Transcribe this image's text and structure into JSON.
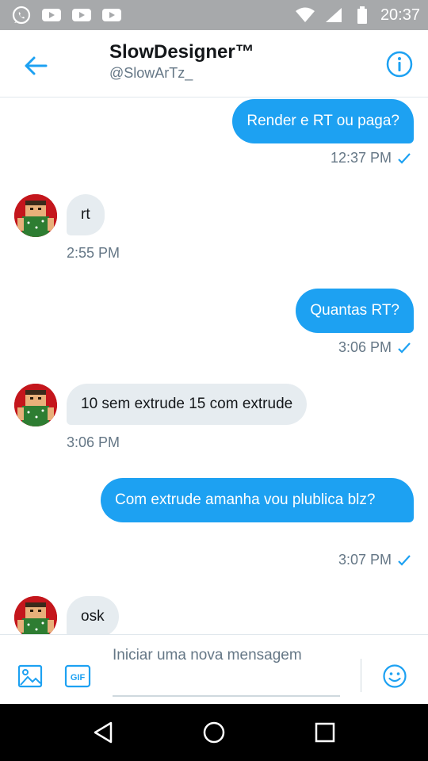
{
  "status_bar": {
    "time": "20:37",
    "icons": [
      "whatsapp-icon",
      "youtube-icon",
      "youtube-icon",
      "youtube-icon",
      "wifi-icon",
      "signal-icon",
      "battery-icon"
    ]
  },
  "header": {
    "display_name": "SlowDesigner™",
    "handle": "@SlowArTz_",
    "back_icon": "arrow-left-icon",
    "info_icon": "info-icon"
  },
  "messages": [
    {
      "direction": "out",
      "text": "Render e RT ou paga?",
      "time": "12:37 PM",
      "read": true
    },
    {
      "direction": "in",
      "text": "rt",
      "time": "2:55 PM"
    },
    {
      "direction": "out",
      "text": "Quantas RT?",
      "time": "3:06 PM",
      "read": true
    },
    {
      "direction": "in",
      "text": "10 sem extrude 15 com extrude",
      "time": "3:06 PM"
    },
    {
      "direction": "out",
      "text": "Com extrude amanha vou plublica blz?",
      "time": "3:07 PM",
      "read": true
    },
    {
      "direction": "in",
      "text": "osk"
    }
  ],
  "compose": {
    "placeholder": "Iniciar uma nova mensagem",
    "gif_label": "GIF",
    "icons": [
      "image-icon",
      "gif-icon",
      "emoji-icon"
    ]
  },
  "nav_bar": {
    "icons": [
      "back-triangle-icon",
      "home-circle-icon",
      "recents-square-icon"
    ]
  },
  "colors": {
    "accent": "#1da1f2",
    "status_bar": "#a7a9ab",
    "bubble_in": "#e6ecf0",
    "avatar_bg": "#c4161c"
  }
}
